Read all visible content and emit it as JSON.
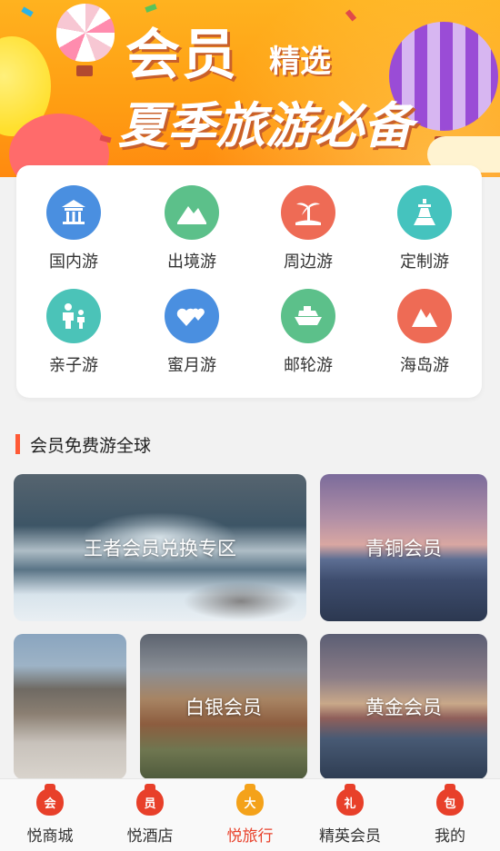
{
  "banner": {
    "title_main": "会员",
    "title_small": "精选",
    "title_second": "夏季旅游必备"
  },
  "categories": [
    {
      "label": "国内游",
      "icon": "temple-icon",
      "color": "#4a8fe0"
    },
    {
      "label": "出境游",
      "icon": "mountain-icon",
      "color": "#5cc08a"
    },
    {
      "label": "周边游",
      "icon": "palm-tree-icon",
      "color": "#ee6b55"
    },
    {
      "label": "定制游",
      "icon": "tower-icon",
      "color": "#45c3be"
    },
    {
      "label": "亲子游",
      "icon": "family-icon",
      "color": "#4bc3b8"
    },
    {
      "label": "蜜月游",
      "icon": "hearts-icon",
      "color": "#4a8fe0"
    },
    {
      "label": "邮轮游",
      "icon": "ship-icon",
      "color": "#5cc08a"
    },
    {
      "label": "海岛游",
      "icon": "island-icon",
      "color": "#ee6b55"
    }
  ],
  "section": {
    "title": "会员免费游全球"
  },
  "tiles": [
    {
      "label": "王者会员兑换专区"
    },
    {
      "label": "青铜会员"
    },
    {
      "label": ""
    },
    {
      "label": "白银会员"
    },
    {
      "label": "黄金会员"
    }
  ],
  "nav": [
    {
      "label": "悦商城",
      "badge": "会",
      "active": false
    },
    {
      "label": "悦酒店",
      "badge": "员",
      "active": false
    },
    {
      "label": "悦旅行",
      "badge": "大",
      "active": true
    },
    {
      "label": "精英会员",
      "badge": "礼",
      "active": false
    },
    {
      "label": "我的",
      "badge": "包",
      "active": false
    }
  ]
}
